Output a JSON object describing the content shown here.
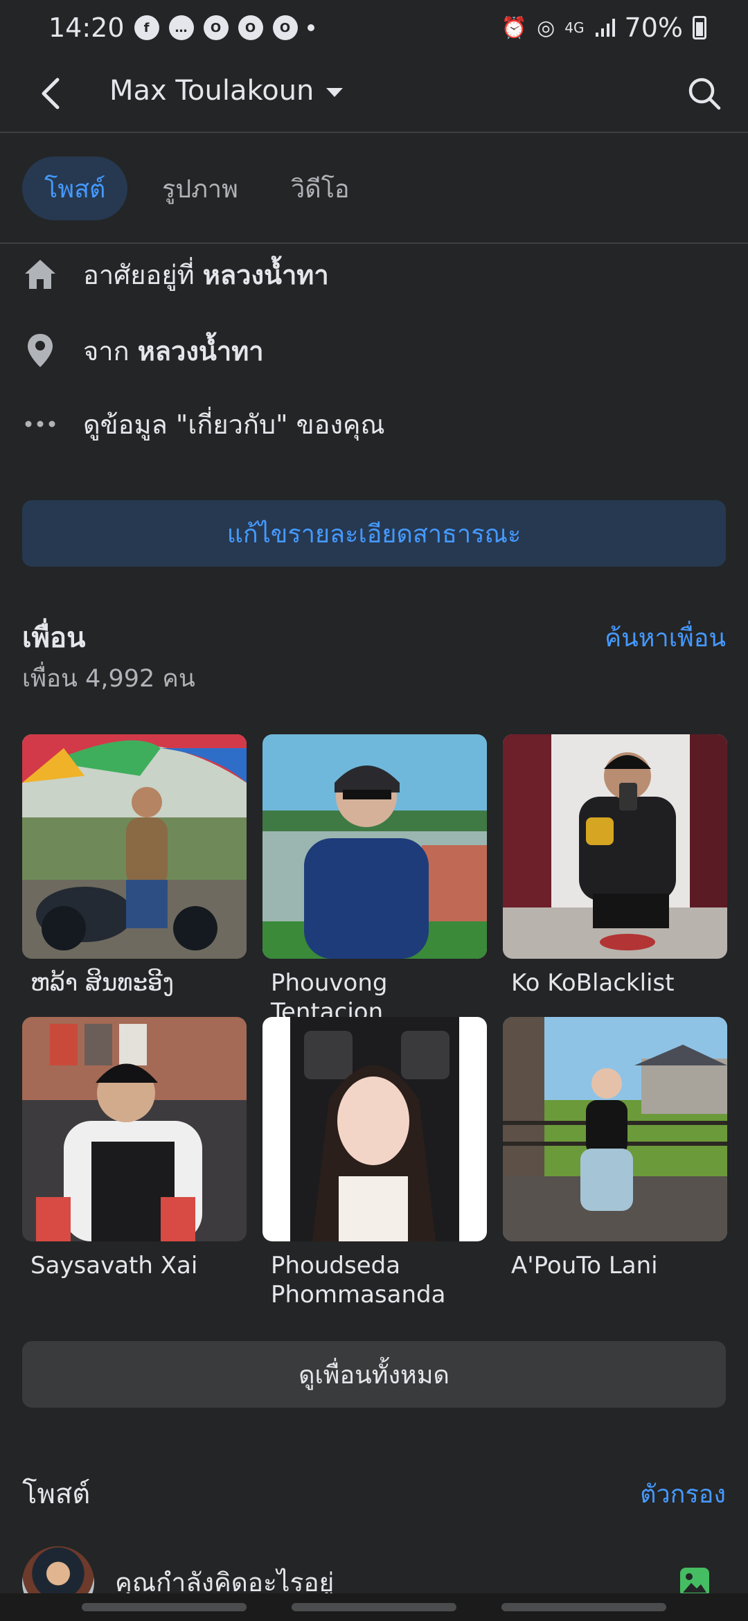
{
  "status_bar": {
    "time": "14:20",
    "battery": "70%",
    "network": "4G"
  },
  "header": {
    "title": "Max Toulakoun"
  },
  "tabs": [
    {
      "label": "โพสต์",
      "active": true
    },
    {
      "label": "รูปภาพ",
      "active": false
    },
    {
      "label": "วิดีโอ",
      "active": false
    }
  ],
  "about": {
    "lives_prefix": "อาศัยอยู่ที่ ",
    "lives_value": "หลวงน้ำทา",
    "from_prefix": "จาก ",
    "from_value": "หลวงน้ำทา",
    "see_about": "ดูข้อมูล \"เกี่ยวกับ\" ของคุณ"
  },
  "edit_details_label": "แก้ไขรายละเอียดสาธารณะ",
  "friends": {
    "title": "เพื่อน",
    "find_link": "ค้นหาเพื่อน",
    "count_text": "เพื่อน 4,992 คน",
    "items": [
      {
        "name": "ຫລ້າ ສິນທະອີງ"
      },
      {
        "name": "Phouvong Tentacion"
      },
      {
        "name": "Ko KoBlacklist"
      },
      {
        "name": "Saysavath Xai"
      },
      {
        "name": "Phoudseda Phommasanda"
      },
      {
        "name": "A'PouTo Lani"
      }
    ],
    "see_all_label": "ดูเพื่อนทั้งหมด"
  },
  "posts": {
    "title": "โพสต์",
    "filter_link": "ตัวกรอง",
    "composer_placeholder": "คุณกำลังคิดอะไรอยู่"
  },
  "colors": {
    "background": "#242526",
    "accent": "#4599ff",
    "accent_bg": "#263951",
    "secondary_button": "#3a3b3c",
    "photo_icon": "#45bd62"
  }
}
